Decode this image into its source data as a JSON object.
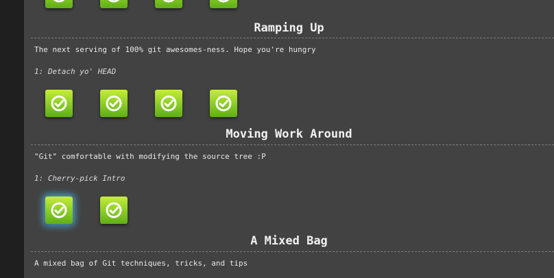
{
  "sections": [
    {
      "title": "Ramping Up",
      "description": "The next serving of 100% git awesomes-ness. Hope you're hungry",
      "current_level": "1: Detach yo' HEAD",
      "level_count": 4
    },
    {
      "title": "Moving Work Around",
      "description": "\"Git\" comfortable with modifying the source tree :P",
      "current_level": "1: Cherry-pick Intro",
      "level_count": 2
    },
    {
      "title": "A Mixed Bag",
      "description": "A mixed bag of Git techniques, tricks, and tips"
    }
  ],
  "icons": {
    "level_tile": "check-circle-icon"
  },
  "colors": {
    "tile_top": "#c7ec3b",
    "tile_bottom": "#5fae17",
    "selected_glow": "#50c8ff"
  }
}
